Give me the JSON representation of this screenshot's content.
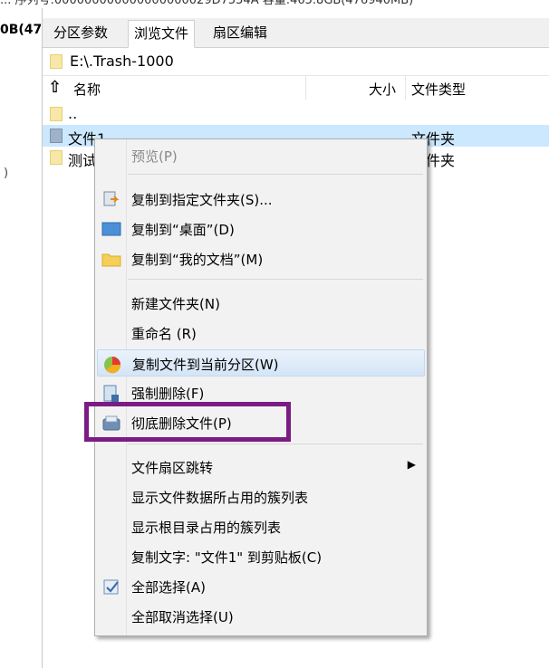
{
  "top_strip": {
    "text": "... 序列号:000000000000000000029D7554A  容量:465.8GB(476940MB)"
  },
  "left_pane": {
    "label": "0B(47",
    "mark": ")"
  },
  "tabs": [
    {
      "label": "分区参数",
      "active": false
    },
    {
      "label": "浏览文件",
      "active": true
    },
    {
      "label": "扇区编辑",
      "active": false
    }
  ],
  "path": {
    "value": "E:\\.Trash-1000"
  },
  "columns": {
    "name": "名称",
    "size": "大小",
    "type": "文件类型"
  },
  "rows": [
    {
      "name": "..",
      "type": "",
      "selected": false,
      "icon": "parent-folder-icon"
    },
    {
      "name": "文件1",
      "type": "文件夹",
      "selected": true,
      "icon": "folder-icon"
    },
    {
      "name": "测试",
      "type": "文件夹",
      "selected": false,
      "icon": "folder-icon"
    }
  ],
  "context_menu": {
    "items": [
      {
        "label": "预览(P)",
        "disabled": true,
        "icon": ""
      },
      {
        "label": "复制到指定文件夹(S)...",
        "disabled": false,
        "icon": "copy-to-folder-icon"
      },
      {
        "label": "复制到“桌面”(D)",
        "disabled": false,
        "icon": "desktop-icon"
      },
      {
        "label": "复制到“我的文档”(M)",
        "disabled": false,
        "icon": "documents-folder-icon"
      },
      {
        "label": "新建文件夹(N)",
        "disabled": false,
        "icon": ""
      },
      {
        "label": "重命名 (R)",
        "disabled": false,
        "icon": ""
      },
      {
        "label": "复制文件到当前分区(W)",
        "disabled": false,
        "icon": "partition-pie-icon",
        "highlighted": true
      },
      {
        "label": "强制删除(F)",
        "disabled": false,
        "icon": "force-delete-icon"
      },
      {
        "label": "彻底删除文件(P)",
        "disabled": false,
        "icon": "shred-delete-icon"
      },
      {
        "label": "文件扇区跳转",
        "disabled": false,
        "icon": "",
        "submenu": true
      },
      {
        "label": "显示文件数据所占用的簇列表",
        "disabled": false,
        "icon": ""
      },
      {
        "label": "显示根目录占用的簇列表",
        "disabled": false,
        "icon": ""
      },
      {
        "label": "复制文字: \"文件1\" 到剪贴板(C)",
        "disabled": false,
        "icon": ""
      },
      {
        "label": "全部选择(A)",
        "disabled": false,
        "icon": "checkbox-icon"
      },
      {
        "label": "全部取消选择(U)",
        "disabled": false,
        "icon": ""
      }
    ]
  },
  "annotation": {
    "color": "#7b1b84"
  }
}
